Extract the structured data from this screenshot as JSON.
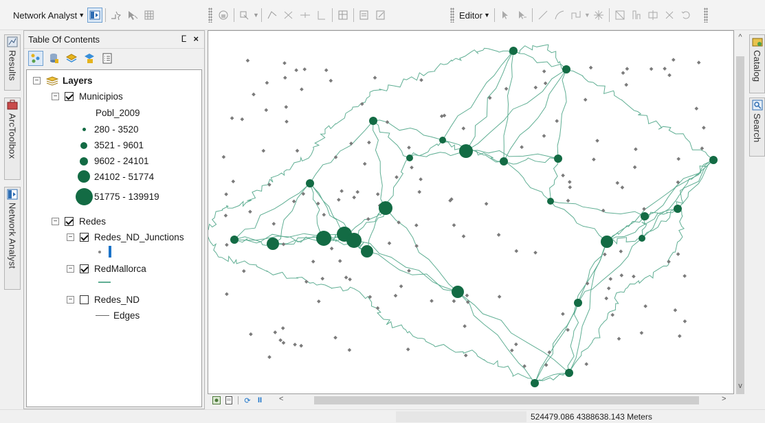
{
  "toolbar": {
    "network_analyst_label": "Network Analyst",
    "editor_label": "Editor"
  },
  "dock_left": {
    "tabs": [
      "Results",
      "ArcToolbox",
      "Network Analyst"
    ]
  },
  "dock_right": {
    "tabs": [
      "Catalog",
      "Search"
    ]
  },
  "toc": {
    "title": "Table Of Contents",
    "pin_glyph": "ⵎ",
    "close_glyph": "×",
    "layers_label": "Layers",
    "municipios": {
      "label": "Municipios",
      "checked": true,
      "field": "Pobl_2009",
      "classes": [
        "280 - 3520",
        "3521 - 9601",
        "9602 - 24101",
        "24102 - 51774",
        "51775 - 139919"
      ]
    },
    "redes": {
      "label": "Redes",
      "checked": true,
      "junctions_label": "Redes_ND_Junctions",
      "redmallorca_label": "RedMallorca",
      "redes_nd_label": "Redes_ND",
      "edges_label": "Edges"
    }
  },
  "status": {
    "coordinates": "524479.086  4388638.143 Meters"
  },
  "colors": {
    "point_fill": "#136b44",
    "road_line": "#5fae93",
    "junction": "#7b7b7b"
  }
}
